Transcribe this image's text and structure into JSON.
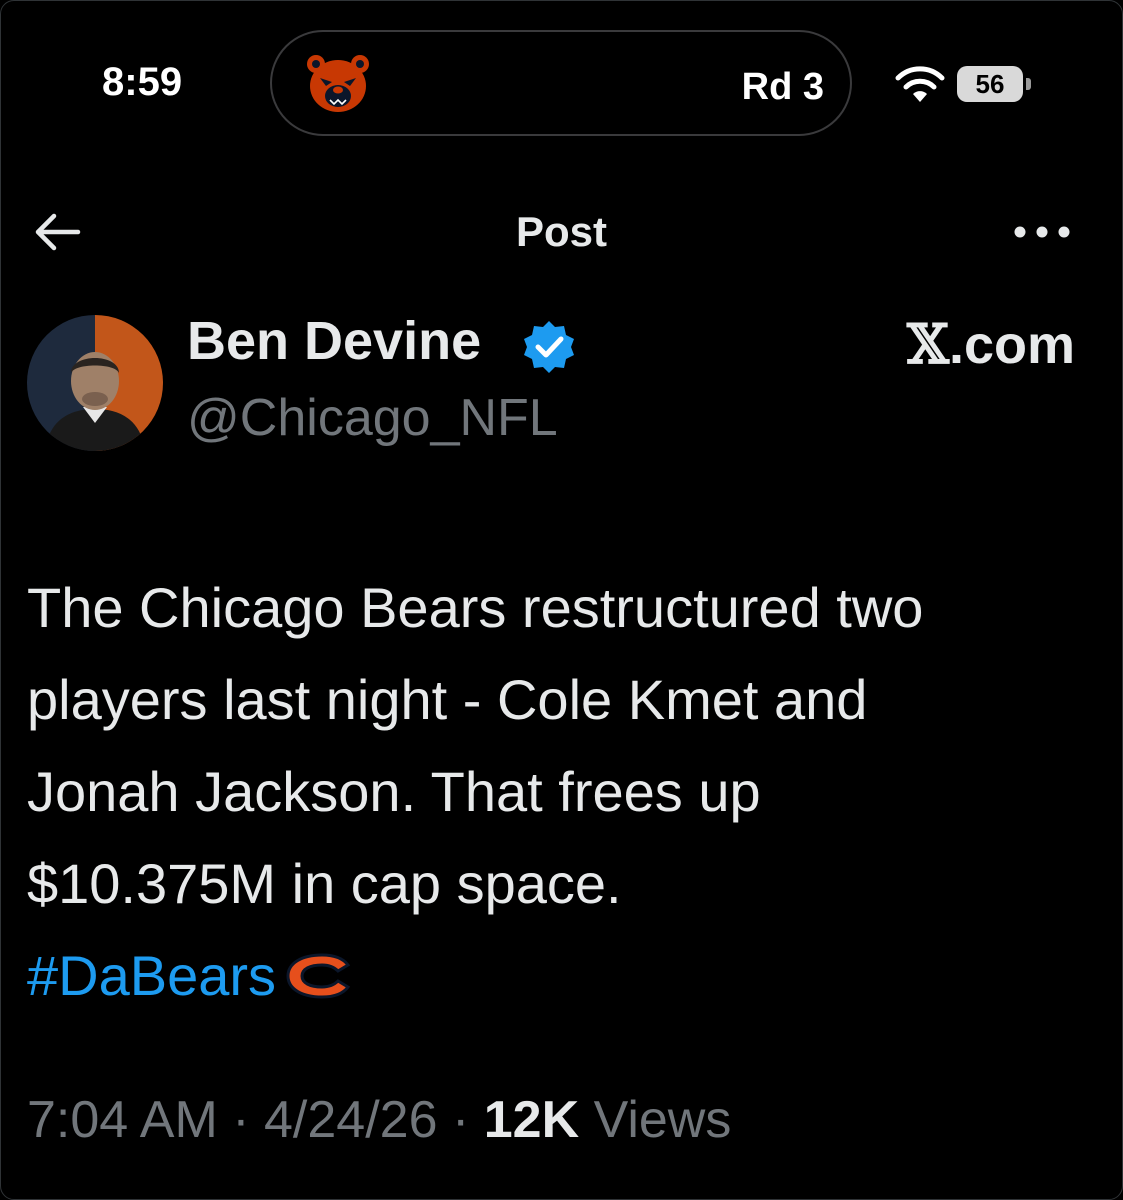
{
  "status_bar": {
    "time": "8:59",
    "live_activity": "Rd 3",
    "battery": "56",
    "icons": [
      "bears-logo-icon",
      "wifi-icon",
      "battery-icon"
    ]
  },
  "header": {
    "title": "Post",
    "back_icon": "back-arrow-icon",
    "more_icon": "more-options-icon"
  },
  "author": {
    "name": "Ben Devine",
    "handle": "@Chicago_NFL",
    "verified_icon": "verified-badge-icon",
    "source_prefix": "𝕏",
    "source_suffix": ".com"
  },
  "post": {
    "lines": [
      "The Chicago Bears restructured two",
      "players last night - Cole Kmet and",
      "Jonah Jackson. That frees up",
      "$10.375M in cap space."
    ],
    "hashtag": "#DaBears",
    "hashtag_icon": "bears-c-logo-icon"
  },
  "meta": {
    "time": "7:04 AM",
    "separator": " · ",
    "date": "4/24/26",
    "views_count": "12K",
    "views_label": "Views"
  },
  "colors": {
    "background": "#000000",
    "text": "#e7e9ea",
    "secondary": "#71767b",
    "accent": "#1d9bf0",
    "bears_orange": "#c83803",
    "bears_navy": "#0b162a"
  }
}
